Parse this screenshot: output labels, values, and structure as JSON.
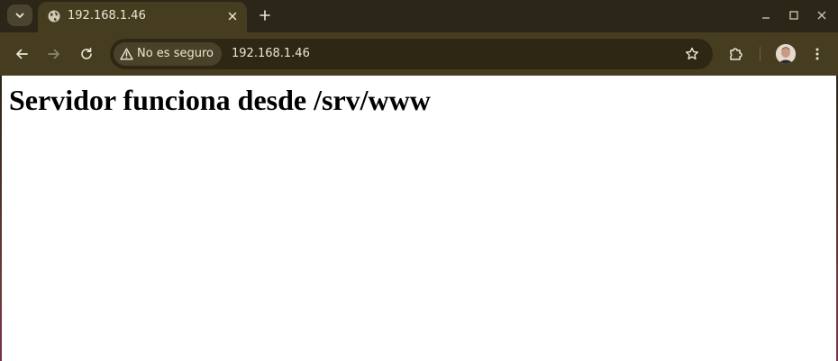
{
  "tab": {
    "title": "192.168.1.46",
    "favicon": "globe-icon"
  },
  "toolbar": {
    "security_label": "No es seguro",
    "url": "192.168.1.46"
  },
  "icons": {
    "tab_search": "chevron-down-icon",
    "close_tab": "close-icon",
    "new_tab": "plus-icon",
    "minimize": "minimize-icon",
    "maximize": "maximize-icon",
    "close_window": "close-icon",
    "back": "arrow-left-icon",
    "forward": "arrow-right-icon",
    "reload": "reload-icon",
    "warning": "warning-icon",
    "bookmark": "star-icon",
    "extensions": "puzzle-icon",
    "profile": "avatar",
    "menu": "more-vert-icon"
  },
  "page": {
    "heading": "Servidor funciona desde /srv/www"
  },
  "colors": {
    "frame": "#2b2618",
    "toolbar": "#463d20",
    "omnibox": "#2e2714",
    "text_light": "#ece6d6",
    "page_bg": "#ffffff"
  }
}
